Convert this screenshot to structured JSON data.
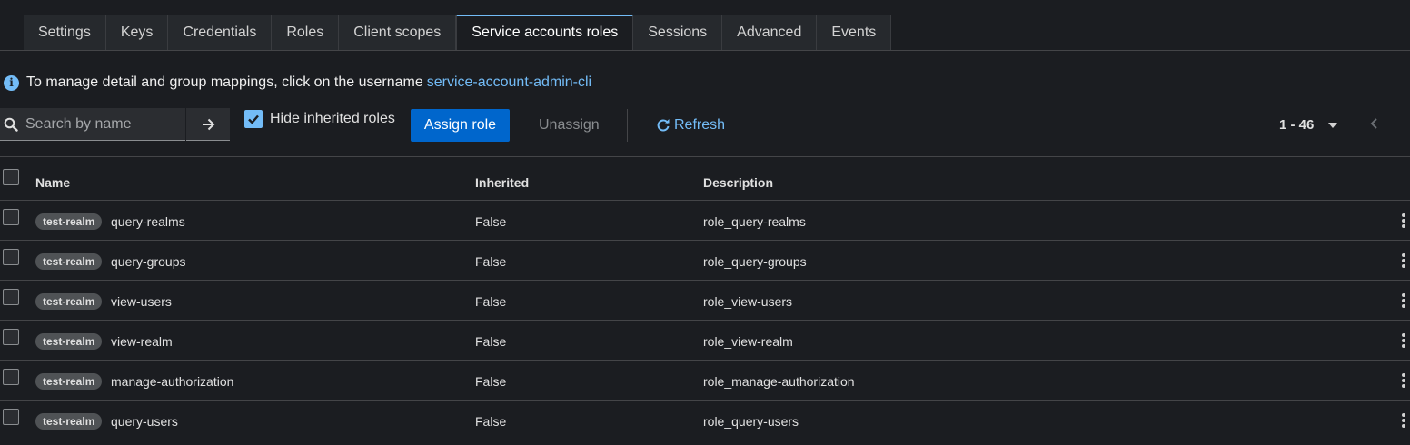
{
  "tabs": [
    {
      "label": "Settings"
    },
    {
      "label": "Keys"
    },
    {
      "label": "Credentials"
    },
    {
      "label": "Roles"
    },
    {
      "label": "Client scopes"
    },
    {
      "label": "Service accounts roles",
      "active": true
    },
    {
      "label": "Sessions"
    },
    {
      "label": "Advanced"
    },
    {
      "label": "Events"
    }
  ],
  "info": {
    "text": "To manage detail and group mappings, click on the username",
    "link": "service-account-admin-cli"
  },
  "toolbar": {
    "search_placeholder": "Search by name",
    "hide_inherited_label": "Hide inherited roles",
    "hide_inherited_checked": true,
    "assign_label": "Assign role",
    "unassign_label": "Unassign",
    "refresh_label": "Refresh",
    "pagination": "1 - 46"
  },
  "table": {
    "headers": {
      "name": "Name",
      "inherited": "Inherited",
      "description": "Description"
    },
    "rows": [
      {
        "badge": "test-realm",
        "name": "query-realms",
        "inherited": "False",
        "description": "role_query-realms"
      },
      {
        "badge": "test-realm",
        "name": "query-groups",
        "inherited": "False",
        "description": "role_query-groups"
      },
      {
        "badge": "test-realm",
        "name": "view-users",
        "inherited": "False",
        "description": "role_view-users"
      },
      {
        "badge": "test-realm",
        "name": "view-realm",
        "inherited": "False",
        "description": "role_view-realm"
      },
      {
        "badge": "test-realm",
        "name": "manage-authorization",
        "inherited": "False",
        "description": "role_manage-authorization"
      },
      {
        "badge": "test-realm",
        "name": "query-users",
        "inherited": "False",
        "description": "role_query-users"
      }
    ]
  },
  "colors": {
    "accent": "#73bcf7",
    "primary": "#0066cc",
    "background": "#1b1d21"
  }
}
